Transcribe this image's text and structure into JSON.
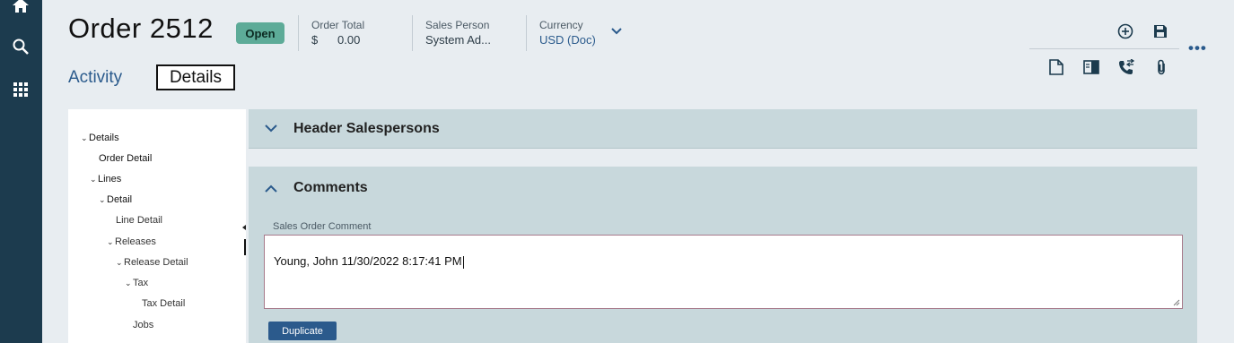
{
  "nav": {
    "icons": [
      "home-icon",
      "search-icon",
      "apps-grid-icon"
    ]
  },
  "header": {
    "title": "Order 2512",
    "status": "Open",
    "order_total_label": "Order Total",
    "order_total_currency": "$",
    "order_total_value": "0.00",
    "sales_person_label": "Sales Person",
    "sales_person_value": "System Ad...",
    "currency_label": "Currency",
    "currency_value": "USD (Doc)"
  },
  "tabs": {
    "activity": "Activity",
    "details": "Details"
  },
  "toolbar": {
    "icons": [
      "add-circle-icon",
      "save-icon",
      "document-icon",
      "panel-icon",
      "phone-transfer-icon",
      "attachment-icon",
      "more-icon"
    ],
    "more": "•••"
  },
  "tree": {
    "items": [
      {
        "label": "Details",
        "expanded": true
      },
      {
        "label": "Order Detail"
      },
      {
        "label": "Lines",
        "expanded": true
      },
      {
        "label": "Detail",
        "expanded": true
      },
      {
        "label": "Line Detail"
      },
      {
        "label": "Releases",
        "expanded": true
      },
      {
        "label": "Release Detail",
        "expanded": true
      },
      {
        "label": "Tax",
        "expanded": true
      },
      {
        "label": "Tax Detail"
      },
      {
        "label": "Jobs"
      }
    ]
  },
  "panels": {
    "header_salespersons": "Header Salespersons",
    "comments": "Comments"
  },
  "comments": {
    "field_label": "Sales Order Comment",
    "value": "Young, John 11/30/2022 8:17:41 PM",
    "duplicate_button": "Duplicate"
  },
  "colors": {
    "nav_bg": "#1c3b4e",
    "accent": "#2b5a8c",
    "status_badge": "#5dab98",
    "panel_bg": "#c8d8dc"
  }
}
